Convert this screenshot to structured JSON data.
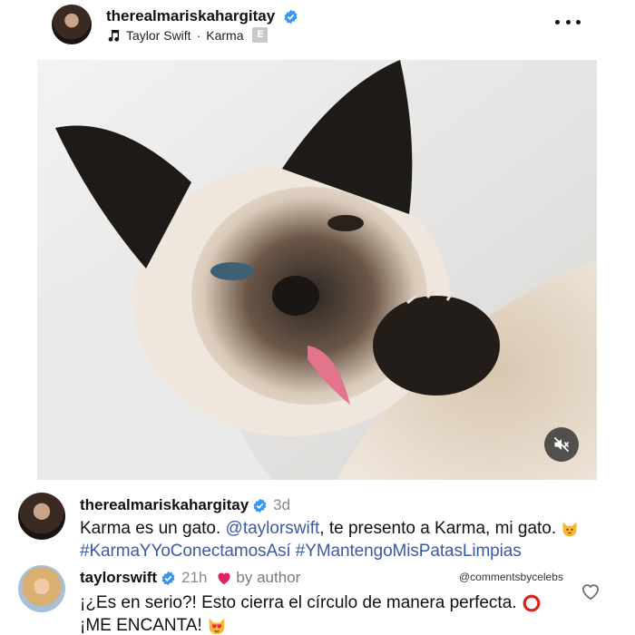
{
  "post": {
    "username": "therealmariskahargitay",
    "audio_artist": "Taylor Swift",
    "audio_separator": "·",
    "audio_title": "Karma",
    "explicit_badge": "E"
  },
  "comments": [
    {
      "username": "therealmariskahargitay",
      "time": "3d",
      "text_before_mention": "Karma es un gato. ",
      "mention": "@taylorswift",
      "text_after_mention": ", te presento a Karma, mi gato.",
      "hashtags": "#KarmaYYoConectamosAsí #YMantengoMisPatasLimpias"
    },
    {
      "username": "taylorswift",
      "time": "21h",
      "by_author": "by author",
      "line1": "¡¿Es en serio?! Esto cierra el círculo de manera perfecta.",
      "line2": "¡ME ENCANTA!"
    }
  ],
  "watermark": "@commentsbycelebs",
  "icons": {
    "more": "more-options-icon",
    "music": "music-note-icon",
    "verified": "verified-badge-icon",
    "mute": "speaker-muted-icon",
    "heart": "red-heart-icon",
    "like": "heart-outline-icon"
  },
  "colors": {
    "verified": "#3797f0",
    "link": "#3b5aa6",
    "muted_text": "#8a8a8a",
    "heart": "#e0245e"
  }
}
